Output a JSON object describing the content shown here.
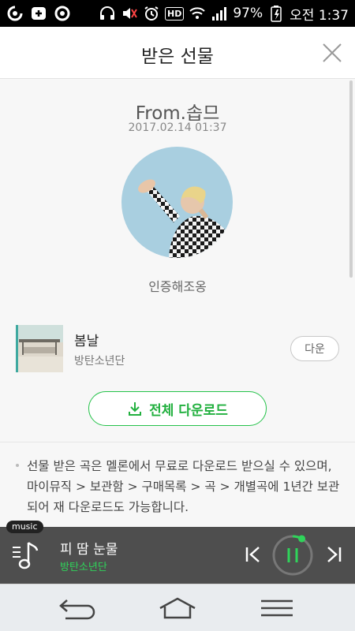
{
  "status_bar": {
    "battery_percent": "97%",
    "time": "오전 1:37",
    "icons": [
      "app-o-icon",
      "app-plus-icon",
      "notification-icon",
      "headset-icon",
      "mute-icon",
      "alarm-icon",
      "hd-icon",
      "wifi-icon",
      "signal-icon",
      "battery-charging-icon"
    ],
    "hd_label": "HD"
  },
  "header": {
    "title": "받은 선물",
    "close_icon": "close-icon"
  },
  "gift": {
    "from": "From.솝므",
    "date": "2017.02.14 01:37",
    "message": "인증해조옹"
  },
  "song": {
    "title": "봄날",
    "artist": "방탄소년단",
    "download_label": "다운"
  },
  "all_download": {
    "label": "전체 다운로드",
    "icon": "download-icon"
  },
  "notice": {
    "text": "선물 받은 곡은 멜론에서 무료로 다운로드 받으실 수 있으며, 마이뮤직 > 보관함 > 구매목록 > 곡 > 개별곡에 1년간 보관되어 재 다운로드도 가능합니다."
  },
  "player": {
    "tag": "music",
    "title": "피 땀 눈물",
    "artist": "방탄소년단",
    "progress": 0.08,
    "accent": "#2fd45a"
  },
  "navbar": {
    "icons": [
      "back-icon",
      "home-icon",
      "menu-icon"
    ]
  },
  "colors": {
    "accent_green": "#25c24a",
    "player_bg": "#4e4e4e"
  }
}
